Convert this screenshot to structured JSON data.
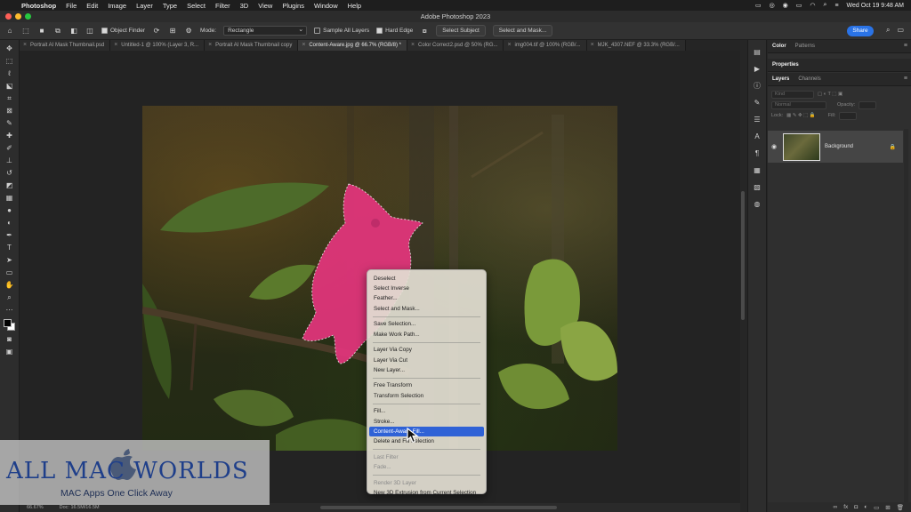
{
  "menubar": {
    "app": "Photoshop",
    "items": [
      "File",
      "Edit",
      "Image",
      "Layer",
      "Type",
      "Select",
      "Filter",
      "3D",
      "View",
      "Plugins",
      "Window",
      "Help"
    ],
    "clock": "Wed Oct 19  9:48 AM"
  },
  "window": {
    "title": "Adobe Photoshop 2023"
  },
  "options": {
    "object_finder": "Object Finder",
    "mode_label": "Mode:",
    "mode_value": "Rectangle",
    "sample_all_layers": "Sample All Layers",
    "hard_edge": "Hard Edge",
    "select_subject": "Select Subject",
    "select_and_mask": "Select and Mask...",
    "share": "Share"
  },
  "tabs": [
    "Portrait AI Mask Thumbnail.psd",
    "Untitled-1 @ 100% (Layer 3, R...",
    "Portrait AI Mask Thumbnail copy",
    "Content-Aware.jpg @ 66.7% (RGB/8) *",
    "Color Correct2.psd @ 50% (RG...",
    "img004.tif @ 100% (RGB/...",
    "MJK_4307.NEF @ 33.3% (RGB/..."
  ],
  "context_menu": [
    {
      "label": "Deselect",
      "disabled": false
    },
    {
      "label": "Select Inverse",
      "disabled": false
    },
    {
      "label": "Feather...",
      "disabled": false
    },
    {
      "label": "Select and Mask...",
      "disabled": false
    },
    {
      "sep": true
    },
    {
      "label": "Save Selection...",
      "disabled": false
    },
    {
      "label": "Make Work Path...",
      "disabled": false
    },
    {
      "sep": true
    },
    {
      "label": "Layer Via Copy",
      "disabled": false
    },
    {
      "label": "Layer Via Cut",
      "disabled": false
    },
    {
      "label": "New Layer...",
      "disabled": false
    },
    {
      "sep": true
    },
    {
      "label": "Free Transform",
      "disabled": false
    },
    {
      "label": "Transform Selection",
      "disabled": false
    },
    {
      "sep": true
    },
    {
      "label": "Fill...",
      "disabled": false
    },
    {
      "label": "Stroke...",
      "disabled": false
    },
    {
      "label": "Content-Aware Fill...",
      "disabled": false,
      "highlighted": true
    },
    {
      "label": "Delete and Fill Selection",
      "disabled": false
    },
    {
      "sep": true
    },
    {
      "label": "Last Filter",
      "disabled": true
    },
    {
      "label": "Fade...",
      "disabled": true
    },
    {
      "sep": true
    },
    {
      "label": "Render 3D Layer",
      "disabled": true
    },
    {
      "label": "New 3D Extrusion from Current Selection",
      "disabled": false
    }
  ],
  "panels": {
    "top_tabs": [
      "Color",
      "Patterns"
    ],
    "properties": "Properties",
    "layer_tabs": [
      "Layers",
      "Channels"
    ],
    "kind": "Kind",
    "blend_mode": "Normal",
    "opacity": "Opacity:",
    "lock": "Lock:",
    "fill": "Fill:",
    "layer_name": "Background"
  },
  "status": {
    "zoom": "66.67%",
    "doc": "Doc: 16.5M/16.5M"
  },
  "watermark": {
    "title": "ALL MAC WORLDS",
    "subtitle": "MAC Apps One Click Away"
  },
  "colors": {
    "accent": "#2a73e6",
    "highlight": "#2f62d6",
    "selection_overlay": "#e8357f"
  }
}
